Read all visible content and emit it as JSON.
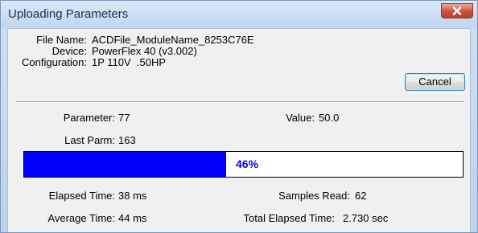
{
  "window": {
    "title": "Uploading Parameters",
    "close_icon": "close-x-icon"
  },
  "file_info": {
    "file_name_label": "File Name:",
    "file_name_value": "ACDFile_ModuleName_8253C76E",
    "device_label": "Device:",
    "device_value": "PowerFlex 40 (v3.002)",
    "configuration_label": "Configuration:",
    "configuration_value": "1P 110V  .50HP"
  },
  "buttons": {
    "cancel_label": "Cancel"
  },
  "parameter": {
    "parameter_label": "Parameter:",
    "parameter_value": "77",
    "value_label": "Value:",
    "value_value": "50.0",
    "last_parm_label": "Last Parm:",
    "last_parm_value": "163"
  },
  "progress": {
    "percent": 46,
    "text": "46%",
    "fill_color": "#0000ff"
  },
  "stats": {
    "elapsed_time_label": "Elapsed Time:",
    "elapsed_time_value": "38 ms",
    "samples_read_label": "Samples Read:",
    "samples_read_value": "62",
    "average_time_label": "Average Time:",
    "average_time_value": "44 ms",
    "total_elapsed_label": "Total Elapsed Time:",
    "total_elapsed_value": "2.730 sec"
  }
}
